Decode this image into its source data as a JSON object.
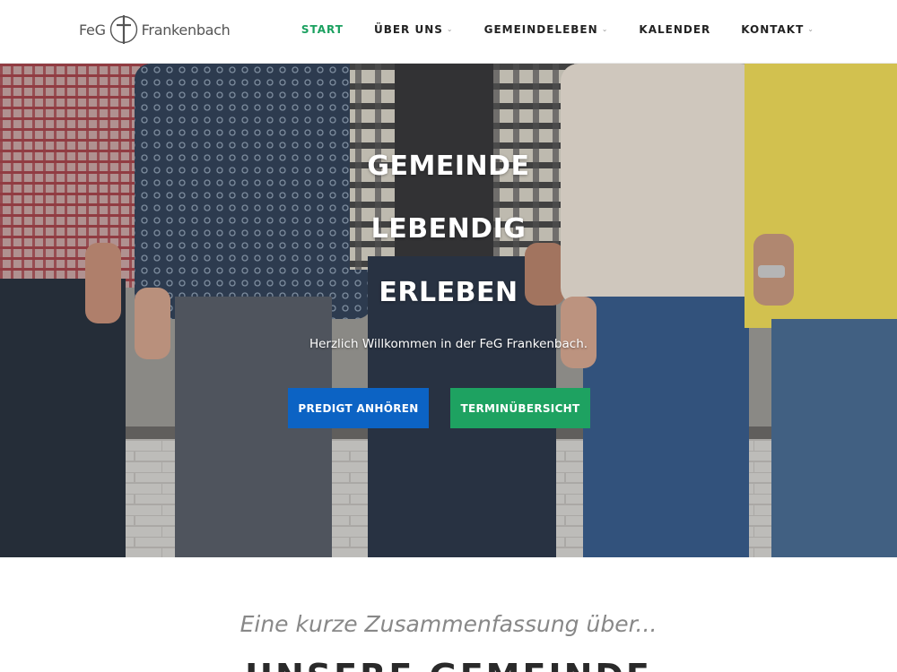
{
  "header": {
    "logo": {
      "left_text": "FeG",
      "right_text": "Frankenbach"
    },
    "nav": [
      {
        "label": "START",
        "active": true,
        "has_dropdown": false
      },
      {
        "label": "ÜBER UNS",
        "active": false,
        "has_dropdown": true
      },
      {
        "label": "GEMEINDELEBEN",
        "active": false,
        "has_dropdown": true
      },
      {
        "label": "KALENDER",
        "active": false,
        "has_dropdown": false
      },
      {
        "label": "KONTAKT",
        "active": false,
        "has_dropdown": true
      }
    ],
    "dropdown_icon": "chevron-down-icon",
    "accent_color": "#1aa05f"
  },
  "hero": {
    "title_lines": [
      "GEMEINDE",
      "LEBENDIG",
      "ERLEBEN"
    ],
    "subtitle": "Herzlich Willkommen in der FeG Frankenbach.",
    "primary_button": {
      "label": "PREDIGT ANHÖREN",
      "color": "#0c63c4"
    },
    "secondary_button": {
      "label": "TERMINÜBERSICHT",
      "color": "#1ea261"
    }
  },
  "section": {
    "intro": "Eine kurze Zusammenfassung über...",
    "heading": "UNSERE GEMEINDE"
  }
}
